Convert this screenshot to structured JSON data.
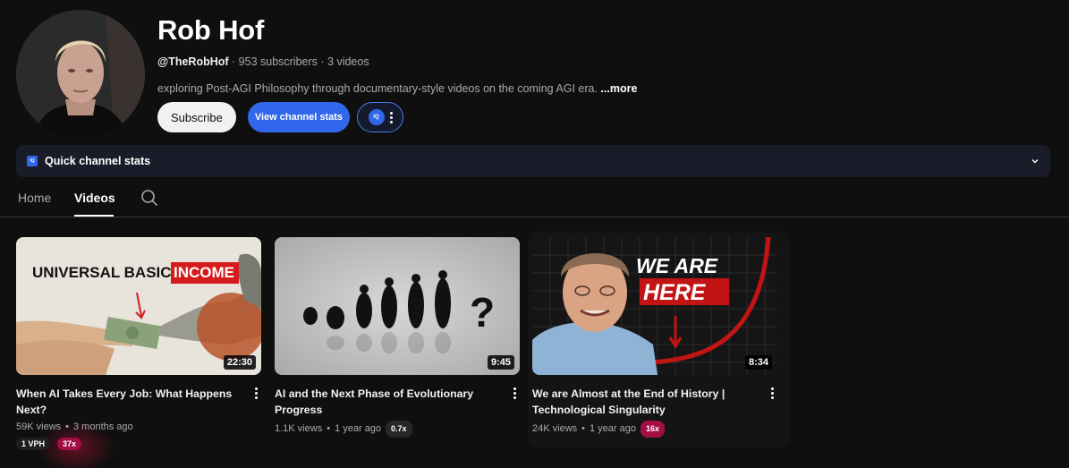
{
  "channel": {
    "name": "Rob Hof",
    "handle": "@TheRobHof",
    "subscribers": "· 953 subscribers",
    "videos_count": "· 3 videos",
    "description": "exploring Post-AGI Philosophy through documentary-style videos on the coming AGI era.",
    "more_label": "...more"
  },
  "buttons": {
    "subscribe": "Subscribe",
    "view_stats": "View channel stats",
    "iq_badge": "IQ"
  },
  "quick_stats": {
    "label": "Quick channel stats",
    "icon_text": "IQ"
  },
  "tabs": {
    "home": "Home",
    "videos": "Videos"
  },
  "colors": {
    "accent_blue": "#3167ea",
    "background": "#0f0f0f",
    "badge_pink": "#a30f45"
  },
  "videos": [
    {
      "title": "When AI Takes Every Job: What Happens Next?",
      "duration": "22:30",
      "views": "59K views",
      "age": "3 months ago",
      "vph": "1 VPH",
      "multiplier": "37x",
      "thumb_text_1": "UNIVERSAL BASIC",
      "thumb_text_2": "INCOME"
    },
    {
      "title": "AI and the Next Phase of Evolutionary Progress",
      "duration": "9:45",
      "views": "1.1K views",
      "age": "1 year ago",
      "multiplier": "0.7x"
    },
    {
      "title": "We are Almost at the End of History | Technological Singularity",
      "duration": "8:34",
      "views": "24K views",
      "age": "1 year ago",
      "multiplier": "16x",
      "thumb_text_1": "WE ARE",
      "thumb_text_2": "HERE"
    }
  ]
}
